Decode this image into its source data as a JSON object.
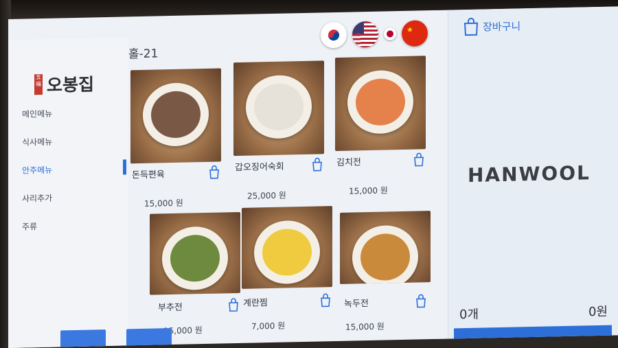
{
  "logo": {
    "mark": "五福",
    "name": "오봉집"
  },
  "table": "홀-21",
  "sidebar": {
    "items": [
      {
        "label": "메인메뉴",
        "active": false
      },
      {
        "label": "식사메뉴",
        "active": false
      },
      {
        "label": "안주메뉴",
        "active": true
      },
      {
        "label": "사리추가",
        "active": false
      },
      {
        "label": "주류",
        "active": false
      }
    ]
  },
  "flags": [
    {
      "name": "korea-flag",
      "lang": "Korean"
    },
    {
      "name": "usa-flag",
      "lang": "English"
    },
    {
      "name": "japan-flag",
      "lang": "Japanese"
    },
    {
      "name": "china-flag",
      "lang": "Chinese"
    }
  ],
  "products": [
    {
      "name": "돈득편육",
      "price": "15,000 원",
      "food_color": "#7a5846"
    },
    {
      "name": "갑오징어숙회",
      "price": "25,000 원",
      "food_color": "#e6e2da"
    },
    {
      "name": "김치전",
      "price": "15,000 원",
      "food_color": "#e5814a"
    },
    {
      "name": "부추전",
      "price": "15,000 원",
      "food_color": "#6d8a3e"
    },
    {
      "name": "계란찜",
      "price": "7,000 원",
      "food_color": "#f0cb40"
    },
    {
      "name": "녹두전",
      "price": "15,000 원",
      "food_color": "#c98a3c"
    }
  ],
  "cart": {
    "title": "장바구니",
    "brand": "HANWOOL",
    "count": "0개",
    "amount": "0원"
  },
  "colors": {
    "accent": "#2d6fd8"
  }
}
